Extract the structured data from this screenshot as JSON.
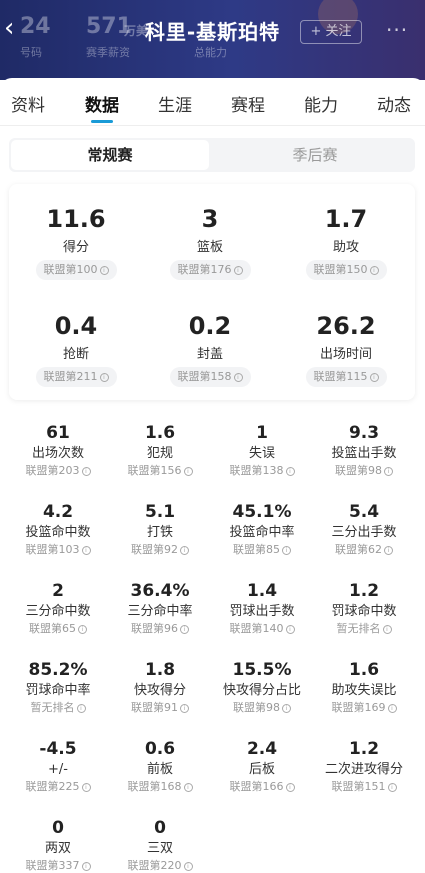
{
  "header": {
    "title": "科里-基斯珀特",
    "follow_label": "+ 关注",
    "more": "···",
    "back": "‹",
    "bg": [
      {
        "num": "24",
        "label": "号码"
      },
      {
        "num": "571",
        "label": "赛季薪资"
      },
      {
        "num": "万美",
        "label": ""
      },
      {
        "num": "",
        "label": "总能力"
      }
    ]
  },
  "tabs": [
    "资料",
    "数据",
    "生涯",
    "赛程",
    "能力",
    "动态"
  ],
  "segment": {
    "regular": "常规赛",
    "playoffs": "季后赛"
  },
  "main_stats": [
    {
      "value": "11.6",
      "name": "得分",
      "rank": "联盟第100"
    },
    {
      "value": "3",
      "name": "篮板",
      "rank": "联盟第176"
    },
    {
      "value": "1.7",
      "name": "助攻",
      "rank": "联盟第150"
    },
    {
      "value": "0.4",
      "name": "抢断",
      "rank": "联盟第211"
    },
    {
      "value": "0.2",
      "name": "封盖",
      "rank": "联盟第158"
    },
    {
      "value": "26.2",
      "name": "出场时间",
      "rank": "联盟第115"
    }
  ],
  "stats": [
    {
      "value": "61",
      "name": "出场次数",
      "rank": "联盟第203"
    },
    {
      "value": "1.6",
      "name": "犯规",
      "rank": "联盟第156"
    },
    {
      "value": "1",
      "name": "失误",
      "rank": "联盟第138"
    },
    {
      "value": "9.3",
      "name": "投篮出手数",
      "rank": "联盟第98"
    },
    {
      "value": "4.2",
      "name": "投篮命中数",
      "rank": "联盟第103"
    },
    {
      "value": "5.1",
      "name": "打铁",
      "rank": "联盟第92"
    },
    {
      "value": "45.1%",
      "name": "投篮命中率",
      "rank": "联盟第85"
    },
    {
      "value": "5.4",
      "name": "三分出手数",
      "rank": "联盟第62"
    },
    {
      "value": "2",
      "name": "三分命中数",
      "rank": "联盟第65"
    },
    {
      "value": "36.4%",
      "name": "三分命中率",
      "rank": "联盟第96"
    },
    {
      "value": "1.4",
      "name": "罚球出手数",
      "rank": "联盟第140"
    },
    {
      "value": "1.2",
      "name": "罚球命中数",
      "rank": "暂无排名"
    },
    {
      "value": "85.2%",
      "name": "罚球命中率",
      "rank": "暂无排名"
    },
    {
      "value": "1.8",
      "name": "快攻得分",
      "rank": "联盟第91"
    },
    {
      "value": "15.5%",
      "name": "快攻得分占比",
      "rank": "联盟第98"
    },
    {
      "value": "1.6",
      "name": "助攻失误比",
      "rank": "联盟第169"
    },
    {
      "value": "-4.5",
      "name": "+/-",
      "rank": "联盟第225"
    },
    {
      "value": "0.6",
      "name": "前板",
      "rank": "联盟第168"
    },
    {
      "value": "2.4",
      "name": "后板",
      "rank": "联盟第166"
    },
    {
      "value": "1.2",
      "name": "二次进攻得分",
      "rank": "联盟第151"
    },
    {
      "value": "0",
      "name": "两双",
      "rank": "联盟第337"
    },
    {
      "value": "0",
      "name": "三双",
      "rank": "联盟第220"
    }
  ],
  "colors": {
    "header": "#26306f",
    "accent": "#1a9bd7"
  }
}
